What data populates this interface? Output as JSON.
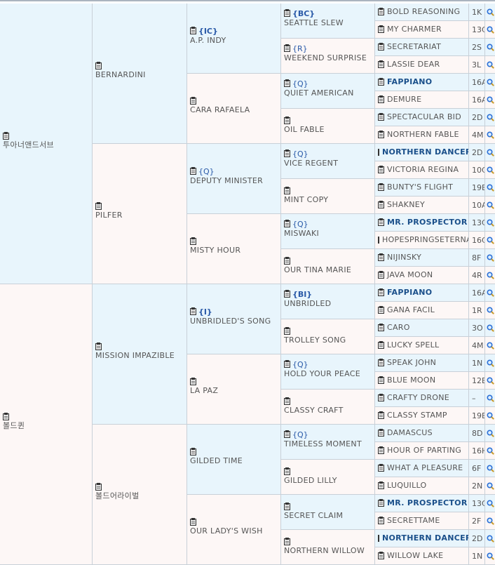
{
  "gen1": [
    {
      "name": "투아너앤드서브"
    },
    {
      "name": "볼드퀸"
    }
  ],
  "gen2": [
    {
      "name": "BERNARDINI"
    },
    {
      "name": "PILFER"
    },
    {
      "name": "MISSION IMPAZIBLE"
    },
    {
      "name": "볼드어라이벌"
    }
  ],
  "gen3": [
    {
      "name": "A.P. INDY",
      "tag": "{IC}"
    },
    {
      "name": "CARA RAFAELA",
      "tag": ""
    },
    {
      "name": "DEPUTY MINISTER",
      "tag": "{Q}"
    },
    {
      "name": "MISTY HOUR",
      "tag": ""
    },
    {
      "name": "UNBRIDLED'S SONG",
      "tag": "{I}"
    },
    {
      "name": "LA PAZ",
      "tag": ""
    },
    {
      "name": "GILDED TIME",
      "tag": ""
    },
    {
      "name": "OUR LADY'S WISH",
      "tag": ""
    }
  ],
  "gen4": [
    {
      "name": "SEATTLE SLEW",
      "tag": "{BC}"
    },
    {
      "name": "WEEKEND SURPRISE",
      "tag": "{R}"
    },
    {
      "name": "QUIET AMERICAN",
      "tag": "{Q}"
    },
    {
      "name": "OIL FABLE",
      "tag": ""
    },
    {
      "name": "VICE REGENT",
      "tag": "{Q}"
    },
    {
      "name": "MINT COPY",
      "tag": ""
    },
    {
      "name": "MISWAKI",
      "tag": "{Q}"
    },
    {
      "name": "OUR TINA MARIE",
      "tag": ""
    },
    {
      "name": "UNBRIDLED",
      "tag": "{BI}"
    },
    {
      "name": "TROLLEY SONG",
      "tag": ""
    },
    {
      "name": "HOLD YOUR PEACE",
      "tag": "{Q}"
    },
    {
      "name": "CLASSY CRAFT",
      "tag": ""
    },
    {
      "name": "TIMELESS MOMENT",
      "tag": "{Q}"
    },
    {
      "name": "GILDED LILLY",
      "tag": ""
    },
    {
      "name": "SECRET CLAIM",
      "tag": ""
    },
    {
      "name": "NORTHERN WILLOW",
      "tag": ""
    }
  ],
  "gen5": [
    {
      "name": "BOLD REASONING",
      "code": "1K"
    },
    {
      "name": "MY CHARMER",
      "code": "13C"
    },
    {
      "name": "SECRETARIAT",
      "code": "2S"
    },
    {
      "name": "LASSIE DEAR",
      "code": "3L"
    },
    {
      "name": "FAPPIANO",
      "code": "16A",
      "bold": true
    },
    {
      "name": "DEMURE",
      "code": "16A"
    },
    {
      "name": "SPECTACULAR BID",
      "code": "2D"
    },
    {
      "name": "NORTHERN FABLE",
      "code": "4M"
    },
    {
      "name": "NORTHERN DANCER",
      "code": "2D",
      "bold": true
    },
    {
      "name": "VICTORIA REGINA",
      "code": "10C"
    },
    {
      "name": "BUNTY'S FLIGHT",
      "code": "19B"
    },
    {
      "name": "SHAKNEY",
      "code": "10A"
    },
    {
      "name": "MR. PROSPECTOR",
      "code": "13C",
      "bold": true
    },
    {
      "name": "HOPESPRINGSETERNAL",
      "code": "16C"
    },
    {
      "name": "NIJINSKY",
      "code": "8F"
    },
    {
      "name": "JAVA MOON",
      "code": "4R"
    },
    {
      "name": "FAPPIANO",
      "code": "16A",
      "bold": true
    },
    {
      "name": "GANA FACIL",
      "code": "1R"
    },
    {
      "name": "CARO",
      "code": "3O"
    },
    {
      "name": "LUCKY SPELL",
      "code": "4M"
    },
    {
      "name": "SPEAK JOHN",
      "code": "1N"
    },
    {
      "name": "BLUE MOON",
      "code": "12B"
    },
    {
      "name": "CRAFTY DRONE",
      "code": "–"
    },
    {
      "name": "CLASSY STAMP",
      "code": "19B"
    },
    {
      "name": "DAMASCUS",
      "code": "8D"
    },
    {
      "name": "HOUR OF PARTING",
      "code": "16H"
    },
    {
      "name": "WHAT A PLEASURE",
      "code": "6F"
    },
    {
      "name": "LUQUILLO",
      "code": "2N"
    },
    {
      "name": "MR. PROSPECTOR",
      "code": "13C",
      "bold": true
    },
    {
      "name": "SECRETTAME",
      "code": "2F"
    },
    {
      "name": "NORTHERN DANCER",
      "code": "2D",
      "bold": true
    },
    {
      "name": "WILLOW LAKE",
      "code": "1N"
    }
  ],
  "icons": {
    "clipboard": "clipboard-icon",
    "search": "search-icon"
  },
  "colors": {
    "blue_cell": "#e8f5fc",
    "pink_cell": "#fdf7f6",
    "link_blue": "#1a4f8a",
    "search_icon": "#2a6fd6"
  }
}
